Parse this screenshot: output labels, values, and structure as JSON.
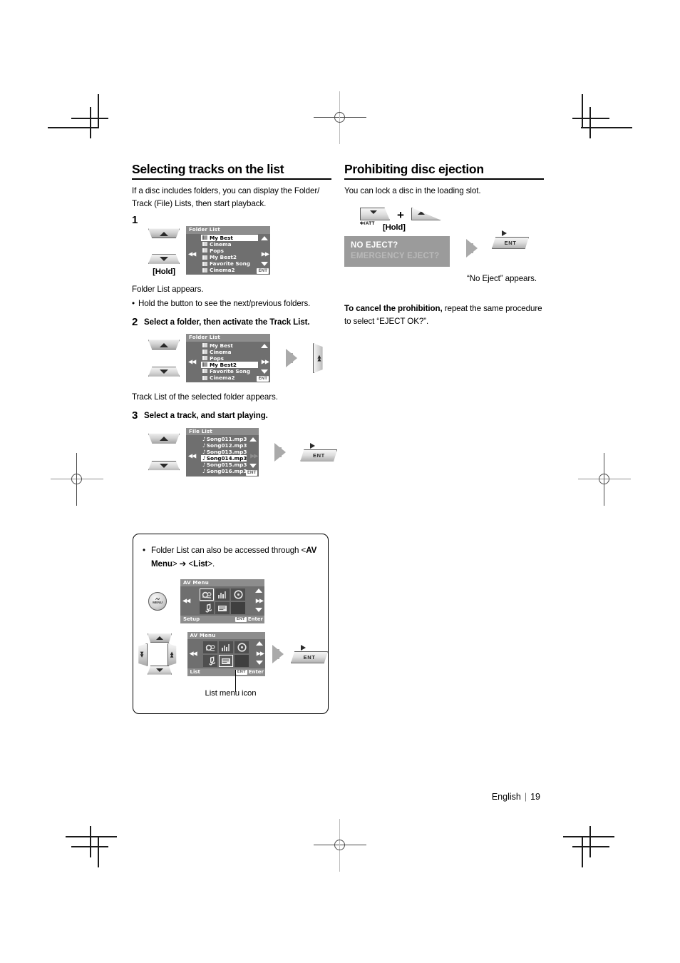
{
  "page": {
    "footer_language": "English",
    "footer_separator": "|",
    "footer_page_number": "19"
  },
  "left_column": {
    "title": "Selecting tracks on the list",
    "intro": "If a disc includes folders, you can display the Folder/ Track (File) Lists, then start playback.",
    "step1": {
      "number": "1",
      "hold_label": "[Hold]",
      "result_text": "Folder List appears.",
      "bullet_dot": "•",
      "bullet_text": "Hold the button to see the next/previous folders.",
      "screen": {
        "title": "Folder List",
        "rows": [
          {
            "label": "My Best",
            "selected": true
          },
          {
            "label": "Cinema",
            "selected": false
          },
          {
            "label": "Pops",
            "selected": false
          },
          {
            "label": "My Best2",
            "selected": false
          },
          {
            "label": "Favorite Song",
            "selected": false
          },
          {
            "label": "Cinema2",
            "selected": false
          }
        ],
        "prev_glyph": "◀◀",
        "next_glyph": "▶▶",
        "enter_chip": "ENT"
      }
    },
    "step2": {
      "number": "2",
      "instruction": "Select a folder, then activate the Track List.",
      "result_text": "Track List of the selected folder appears.",
      "screen": {
        "title": "Folder List",
        "rows": [
          {
            "label": "My Best",
            "selected": false
          },
          {
            "label": "Cinema",
            "selected": false
          },
          {
            "label": "Pops",
            "selected": false
          },
          {
            "label": "My Best2",
            "selected": true
          },
          {
            "label": "Favorite Song",
            "selected": false
          },
          {
            "label": "Cinema2",
            "selected": false
          }
        ],
        "prev_glyph": "◀◀",
        "next_glyph": "▶▶",
        "enter_chip": "ENT"
      }
    },
    "step3": {
      "number": "3",
      "instruction": "Select a track, and start playing.",
      "screen": {
        "title": "File List",
        "rows": [
          {
            "label": "Song011.mp3",
            "selected": false
          },
          {
            "label": "Song012.mp3",
            "selected": false
          },
          {
            "label": "Song013.mp3",
            "selected": false
          },
          {
            "label": "Song014.mp3",
            "selected": true
          },
          {
            "label": "Song015.mp3",
            "selected": false
          },
          {
            "label": "Song016.mp3",
            "selected": false
          }
        ],
        "note_glyph": "♪",
        "prev_glyph": "◀◀",
        "next_glyph": "▶▶",
        "enter_chip": "ENT"
      },
      "ent_button_label": "ENT"
    }
  },
  "right_column": {
    "title": "Prohibiting disc ejection",
    "intro": "You can lock a disc in the loading slot.",
    "buttons": {
      "att_label": "Φ/ATT",
      "plus": "+",
      "hold_label": "[Hold]",
      "ent_label": "ENT"
    },
    "message_box": {
      "line1": "NO EJECT?",
      "line2": "EMERGENCY EJECT?"
    },
    "result_caption": "“No Eject” appears.",
    "cancel_bold": "To cancel the prohibition,",
    "cancel_rest": " repeat the same procedure to select “EJECT OK?”."
  },
  "note_box": {
    "bullet_dot": "•",
    "text_part1": "Folder List can also be accessed through <",
    "text_bold1": "AV Menu",
    "text_part2": "> ",
    "arrow": "➔",
    "text_part3": " <",
    "text_bold2": "List",
    "text_part4": ">.",
    "av_menu_button": {
      "line1": "AV",
      "line2": "MENU"
    },
    "screen_a": {
      "title": "AV Menu",
      "footer_label": "Setup",
      "enter_chip": "ENT",
      "enter_word": "Enter",
      "prev_glyph": "◀◀",
      "next_glyph": "▶▶",
      "highlight": "setup"
    },
    "screen_b": {
      "title": "AV Menu",
      "footer_label": "List",
      "enter_chip": "ENT",
      "enter_word": "Enter",
      "prev_glyph": "◀◀",
      "next_glyph": "▶▶",
      "highlight": "list"
    },
    "ent_button_label": "ENT",
    "caption": "List menu icon"
  },
  "colors": {
    "lcd_body": "#6f6f6f",
    "lcd_title_bar": "#8d8d8d",
    "message_box": "#9b9b9b",
    "arrow_grey": "#aaaaaa",
    "text": "#000000"
  }
}
